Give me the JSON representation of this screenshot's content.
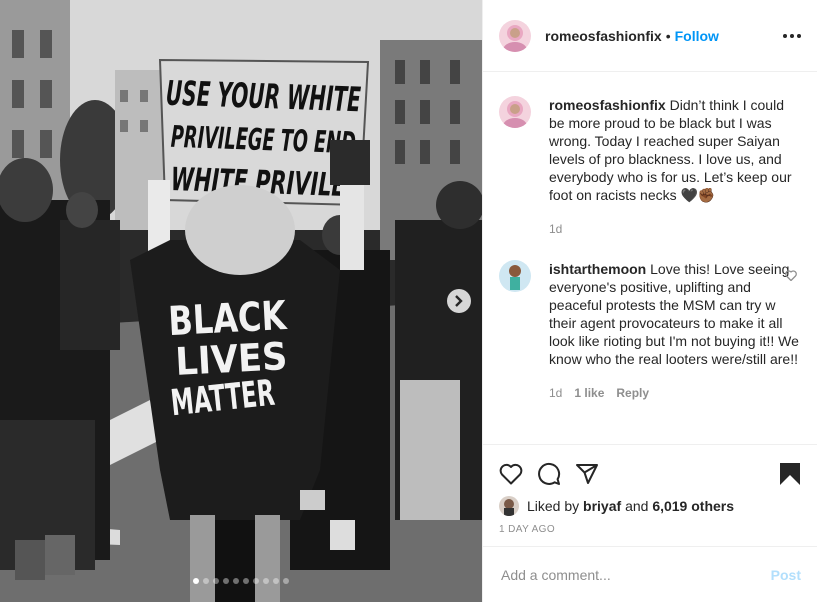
{
  "post": {
    "username": "romeosfashionfix",
    "separator": "•",
    "follow_label": "Follow",
    "photo": {
      "sign_text": [
        "USE YOUR WHITE",
        "PRIVILEGE TO END",
        "WHITE PRIVILE"
      ],
      "jacket_text": [
        "BLACK",
        "LIVES",
        "MATTER"
      ],
      "slide_count": 10,
      "active_slide": 1
    },
    "caption": {
      "username": "romeosfashionfix",
      "text": "Didn’t think I could be more proud to be black but I was wrong. Today I reached super Saiyan levels of pro blackness. I love us, and everybody who is for us. Let’s keep our foot on racists necks 🖤✊🏾",
      "time": "1d"
    },
    "comments": [
      {
        "username": "ishtarthemoon",
        "text": "Love this! Love seeing everyone's positive, uplifting and peaceful protests the MSM can try w their agent provocateurs to make it all look like rioting but I'm not buying it!! We know who the real looters were/still are!!",
        "time": "1d",
        "likes": "1 like",
        "reply_label": "Reply"
      }
    ],
    "likes": {
      "prefix": "Liked by",
      "first_user": "briyaf",
      "conjunction": "and",
      "others": "6,019 others"
    },
    "date": "1 DAY AGO",
    "add_comment": {
      "placeholder": "Add a comment...",
      "post_label": "Post"
    },
    "icons": [
      "heart-icon",
      "comment-icon",
      "share-icon",
      "bookmark-icon",
      "more-options-icon",
      "chevron-right-icon"
    ],
    "colors": {
      "link_blue": "#0095f6",
      "post_disabled": "#b2dffc",
      "meta_gray": "#8e8e8e",
      "border": "#efefef"
    }
  }
}
